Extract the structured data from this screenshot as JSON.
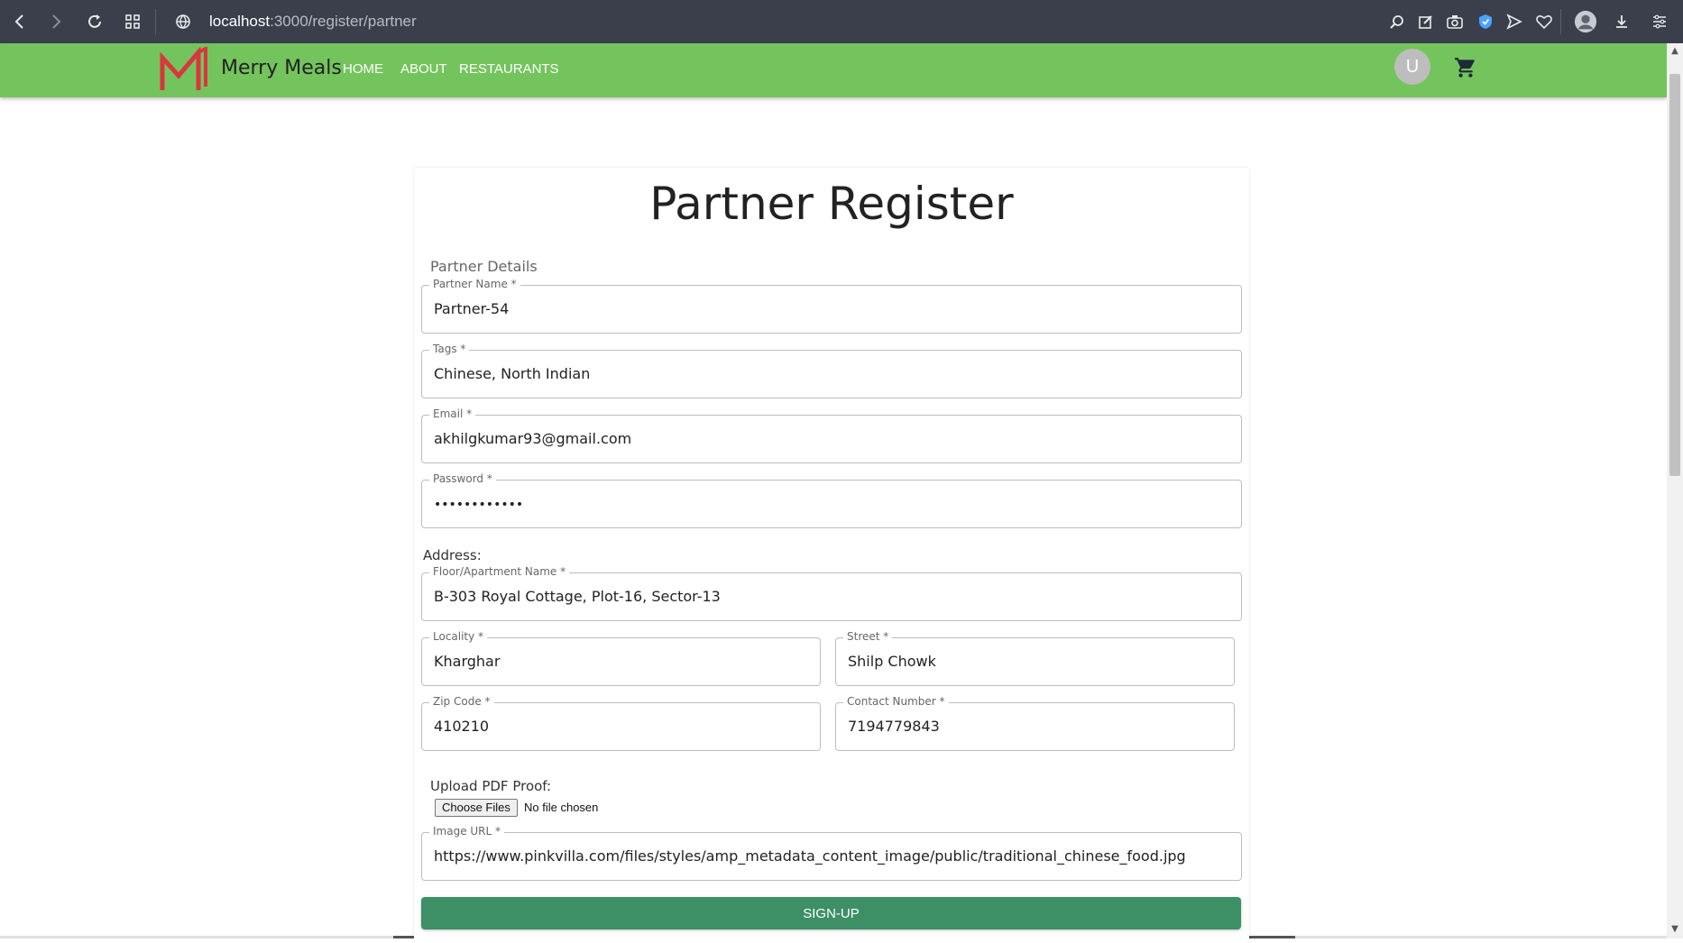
{
  "browser": {
    "url_host": "localhost",
    "url_path": ":3000/register/partner"
  },
  "header": {
    "brand": "Merry Meals",
    "nav": [
      "HOME",
      "ABOUT",
      "RESTAURANTS"
    ],
    "avatar_initial": "U"
  },
  "form": {
    "title": "Partner Register",
    "section": "Partner Details",
    "partner_name": {
      "label": "Partner Name *",
      "value": "Partner-54"
    },
    "tags": {
      "label": "Tags *",
      "value": "Chinese, North Indian"
    },
    "email": {
      "label": "Email *",
      "value": "akhilgkumar93@gmail.com"
    },
    "password": {
      "label": "Password *",
      "value": "••••••••••••"
    },
    "address_label": "Address:",
    "floor": {
      "label": "Floor/Apartment Name *",
      "value": "B-303 Royal Cottage, Plot-16, Sector-13"
    },
    "locality": {
      "label": "Locality *",
      "value": "Kharghar"
    },
    "street": {
      "label": "Street *",
      "value": "Shilp Chowk"
    },
    "zip": {
      "label": "Zip Code *",
      "value": "410210"
    },
    "contact": {
      "label": "Contact Number *",
      "value": "7194779843"
    },
    "upload_label": "Upload PDF Proof:",
    "choose_files": "Choose Files",
    "no_file": "No file chosen",
    "image_url": {
      "label": "Image URL *",
      "value": "https://www.pinkvilla.com/files/styles/amp_metadata_content_image/public/traditional_chinese_food.jpg"
    },
    "submit": "SIGN-UP"
  },
  "colors": {
    "appbar": "#74c45d",
    "button": "#3d8f66",
    "logo": "#d9363e"
  },
  "icons": {
    "left": [
      "back-icon",
      "forward-icon",
      "reload-icon",
      "tabs-grid-icon",
      "site-info-icon"
    ],
    "right": [
      "search-icon",
      "edit-icon",
      "camera-icon",
      "shield-icon",
      "send-icon",
      "heart-icon",
      "profile-icon",
      "download-icon",
      "menu-icon"
    ]
  }
}
